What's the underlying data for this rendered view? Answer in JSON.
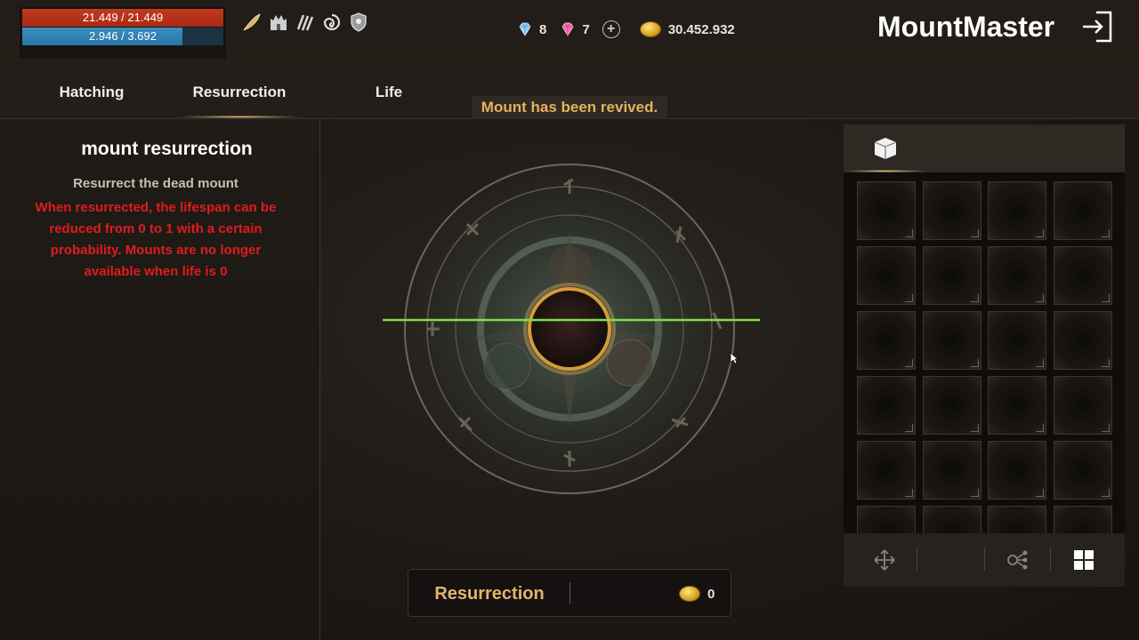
{
  "player": {
    "hp_text": "21.449 / 21.449",
    "hp_fraction": 1.0,
    "mp_text": "2.946 / 3.692",
    "mp_fraction": 0.798,
    "hp_color": "#b8321a",
    "mp_color": "#2f82b4"
  },
  "buffs": [
    "feather-buff-icon",
    "castle-buff-icon",
    "claw-buff-icon",
    "swirl-buff-icon",
    "shield-buff-icon"
  ],
  "currency": {
    "blue_gem_count": "8",
    "pink_gem_count": "7",
    "gold_amount": "30.452.932"
  },
  "header": {
    "title": "MountMaster"
  },
  "tabs": [
    {
      "label": "Hatching",
      "active": false
    },
    {
      "label": "Resurrection",
      "active": true
    },
    {
      "label": "Life",
      "active": false
    }
  ],
  "notice": "Mount has been revived.",
  "left_panel": {
    "title": "mount resurrection",
    "description": "Resurrect the dead mount",
    "warning_lines": [
      "When resurrected, the lifespan can be",
      "reduced from 0 to 1 with a certain",
      "probability. Mounts are no longer",
      "available when life is 0"
    ],
    "warning_color": "#e01c1c"
  },
  "action": {
    "button_label": "Resurrection",
    "cost": "0"
  },
  "inventory": {
    "tab_icon": "box-icon",
    "slot_rows_visible": 6,
    "slot_cols": 4,
    "footer_icons": [
      "move-icon",
      "share-icon",
      "grid-view-icon"
    ]
  },
  "colors": {
    "accent_gold": "#e2b46c",
    "notice_text": "#e7b15c"
  }
}
